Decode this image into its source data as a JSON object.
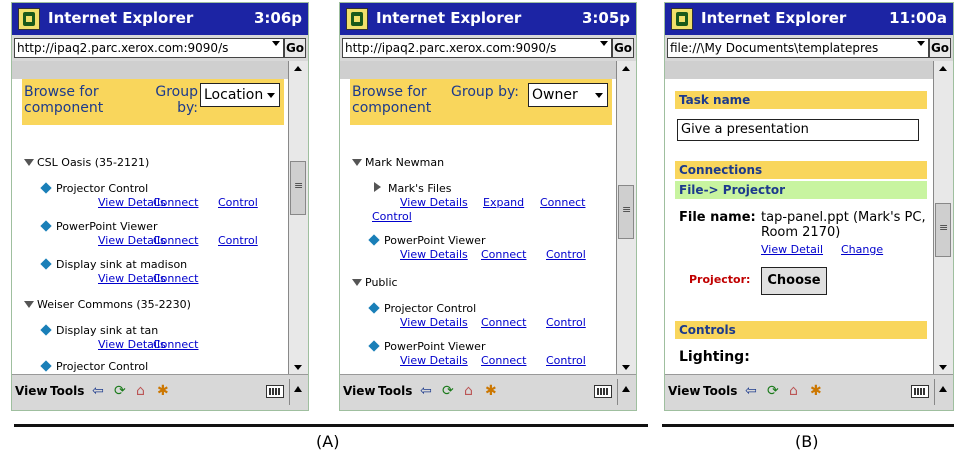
{
  "common": {
    "app_title": "Internet Explorer",
    "go_label": "Go",
    "bottom_view": "View",
    "bottom_tools": "Tools"
  },
  "panelA": {
    "time": "3:06p",
    "address": "http://ipaq2.parc.xerox.com:9090/s",
    "browse_label": "Browse for component",
    "group_by_label": "Group by:",
    "group_value": "Location",
    "groups": [
      {
        "name": "CSL Oasis (35-2121)",
        "items": [
          {
            "name": "Projector Control",
            "links": [
              "View Details",
              "Connect",
              "Control"
            ]
          },
          {
            "name": "PowerPoint Viewer",
            "links": [
              "View Details",
              "Connect",
              "Control"
            ]
          },
          {
            "name": "Display sink at madison",
            "links": [
              "View Details",
              "Connect"
            ]
          }
        ]
      },
      {
        "name": "Weiser Commons (35-2230)",
        "items": [
          {
            "name": "Display sink at tan",
            "links": [
              "View Details",
              "Connect"
            ]
          },
          {
            "name": "Projector Control",
            "links": []
          }
        ]
      }
    ]
  },
  "panelA2": {
    "time": "3:05p",
    "address": "http://ipaq2.parc.xerox.com:9090/s",
    "browse_label": "Browse for component",
    "group_by_label": "Group by:",
    "group_value": "Owner",
    "groups": [
      {
        "name": "Mark Newman",
        "items": [
          {
            "name": "Mark's Files",
            "links": [
              "View Details",
              "Expand",
              "Connect",
              "Control"
            ]
          },
          {
            "name": "PowerPoint Viewer",
            "links": [
              "View Details",
              "Connect",
              "Control"
            ]
          }
        ]
      },
      {
        "name": "Public",
        "items": [
          {
            "name": "Projector Control",
            "links": [
              "View Details",
              "Connect",
              "Control"
            ]
          },
          {
            "name": "PowerPoint Viewer",
            "links": [
              "View Details",
              "Connect",
              "Control"
            ]
          }
        ]
      }
    ]
  },
  "panelB": {
    "time": "11:00a",
    "address": "file://\\My Documents\\templatepres",
    "task_name_label": "Task name",
    "task_name_value": "Give a presentation",
    "connections_label": "Connections",
    "connection_label": "File-> Projector",
    "file_name_label": "File name:",
    "file_name_value": "tap-panel.ppt (Mark's PC, Room 2170)",
    "view_detail": "View Detail",
    "change": "Change",
    "projector_label": "Projector:",
    "choose_label": "Choose",
    "controls_label": "Controls",
    "lighting_label": "Lighting:"
  },
  "captions": {
    "a": "(A)",
    "b": "(B)"
  }
}
